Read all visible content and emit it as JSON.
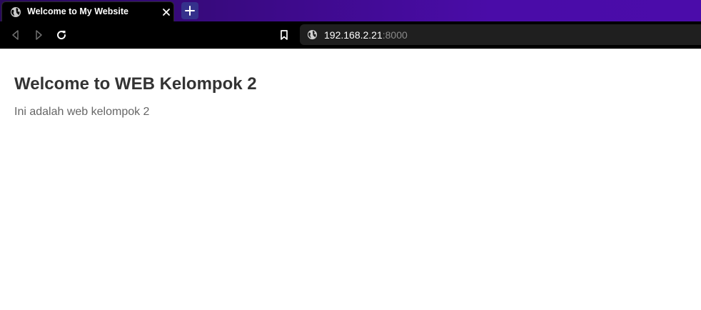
{
  "browser": {
    "tab": {
      "title": "Welcome to My Website",
      "icon": "globe-icon",
      "close_icon": "close-icon"
    },
    "new_tab_icon": "plus-icon",
    "toolbar": {
      "back_icon": "back-arrow-icon",
      "forward_icon": "forward-arrow-icon",
      "reload_icon": "reload-icon",
      "bookmark_icon": "bookmark-icon"
    },
    "address": {
      "icon": "globe-icon",
      "host": "192.168.2.21",
      "port": ":8000"
    },
    "colors": {
      "tabstrip_start": "#2a0a5c",
      "tabstrip_end": "#4b0caa",
      "new_tab_bg": "#35318c",
      "toolbar_bg": "#000000",
      "urlbar_bg": "#1f1f1f"
    }
  },
  "page": {
    "heading": "Welcome to WEB Kelompok 2",
    "paragraph": "Ini adalah web kelompok 2",
    "colors": {
      "heading": "#333333",
      "paragraph": "#666666"
    }
  }
}
